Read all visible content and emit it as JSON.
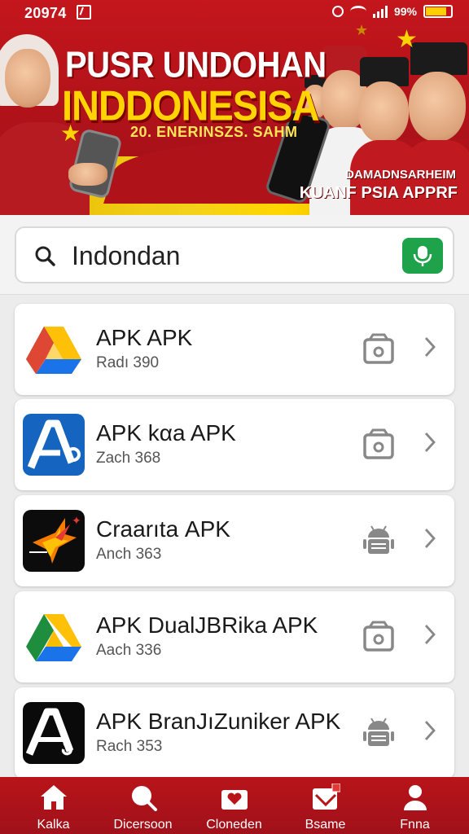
{
  "status_bar": {
    "time": "20974",
    "battery_text": "99%"
  },
  "banner": {
    "headline_line1": "PUSR UNDOHAN",
    "headline_line2": "INDDONESISA",
    "subline": "20. ENERINSZS. SAHM",
    "promo_line1": "DAMADNSARHEIM",
    "promo_line2": "KUANF PSIA APPRF",
    "colors": {
      "red": "#c4161c",
      "yellow": "#ffd400"
    }
  },
  "search": {
    "value": "Indondan",
    "search_icon": "search-icon",
    "mic_icon": "microphone-icon",
    "mic_color": "#1fa34a"
  },
  "apps": [
    {
      "title": "APK APK",
      "sub": "Radı 390",
      "icon": "drive-icon",
      "type_icon": "package-icon"
    },
    {
      "title": "APK kαa APK",
      "sub": "Zach 368",
      "icon": "a-letter-blue-icon",
      "type_icon": "package-icon"
    },
    {
      "title": "Craarıtа APK",
      "sub": "Anch 363",
      "icon": "star-bolt-icon",
      "type_icon": "android-icon"
    },
    {
      "title": "APK DualJBRika APK",
      "sub": "Aach 336",
      "icon": "drive-icon",
      "type_icon": "package-icon"
    },
    {
      "title": "APK BranJıZuniker APK",
      "sub": "Rach 353",
      "icon": "a-letter-black-icon",
      "type_icon": "android-icon"
    }
  ],
  "bottom_nav": [
    {
      "label": "Kalka",
      "icon": "home-icon"
    },
    {
      "label": "Dicersoon",
      "icon": "search-icon"
    },
    {
      "label": "Cloneden",
      "icon": "heart-box-icon"
    },
    {
      "label": "Bsame",
      "icon": "inbox-icon"
    },
    {
      "label": "Fnna",
      "icon": "profile-icon"
    }
  ]
}
